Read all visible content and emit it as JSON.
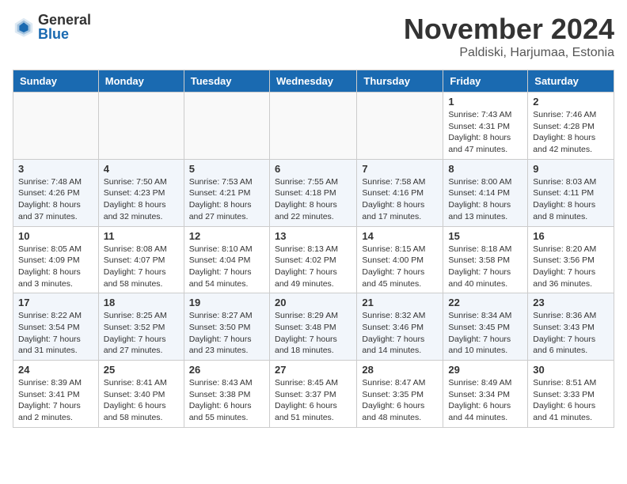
{
  "header": {
    "logo_general": "General",
    "logo_blue": "Blue",
    "month_title": "November 2024",
    "subtitle": "Paldiski, Harjumaa, Estonia"
  },
  "weekdays": [
    "Sunday",
    "Monday",
    "Tuesday",
    "Wednesday",
    "Thursday",
    "Friday",
    "Saturday"
  ],
  "weeks": [
    [
      {
        "day": "",
        "info": ""
      },
      {
        "day": "",
        "info": ""
      },
      {
        "day": "",
        "info": ""
      },
      {
        "day": "",
        "info": ""
      },
      {
        "day": "",
        "info": ""
      },
      {
        "day": "1",
        "info": "Sunrise: 7:43 AM\nSunset: 4:31 PM\nDaylight: 8 hours and 47 minutes."
      },
      {
        "day": "2",
        "info": "Sunrise: 7:46 AM\nSunset: 4:28 PM\nDaylight: 8 hours and 42 minutes."
      }
    ],
    [
      {
        "day": "3",
        "info": "Sunrise: 7:48 AM\nSunset: 4:26 PM\nDaylight: 8 hours and 37 minutes."
      },
      {
        "day": "4",
        "info": "Sunrise: 7:50 AM\nSunset: 4:23 PM\nDaylight: 8 hours and 32 minutes."
      },
      {
        "day": "5",
        "info": "Sunrise: 7:53 AM\nSunset: 4:21 PM\nDaylight: 8 hours and 27 minutes."
      },
      {
        "day": "6",
        "info": "Sunrise: 7:55 AM\nSunset: 4:18 PM\nDaylight: 8 hours and 22 minutes."
      },
      {
        "day": "7",
        "info": "Sunrise: 7:58 AM\nSunset: 4:16 PM\nDaylight: 8 hours and 17 minutes."
      },
      {
        "day": "8",
        "info": "Sunrise: 8:00 AM\nSunset: 4:14 PM\nDaylight: 8 hours and 13 minutes."
      },
      {
        "day": "9",
        "info": "Sunrise: 8:03 AM\nSunset: 4:11 PM\nDaylight: 8 hours and 8 minutes."
      }
    ],
    [
      {
        "day": "10",
        "info": "Sunrise: 8:05 AM\nSunset: 4:09 PM\nDaylight: 8 hours and 3 minutes."
      },
      {
        "day": "11",
        "info": "Sunrise: 8:08 AM\nSunset: 4:07 PM\nDaylight: 7 hours and 58 minutes."
      },
      {
        "day": "12",
        "info": "Sunrise: 8:10 AM\nSunset: 4:04 PM\nDaylight: 7 hours and 54 minutes."
      },
      {
        "day": "13",
        "info": "Sunrise: 8:13 AM\nSunset: 4:02 PM\nDaylight: 7 hours and 49 minutes."
      },
      {
        "day": "14",
        "info": "Sunrise: 8:15 AM\nSunset: 4:00 PM\nDaylight: 7 hours and 45 minutes."
      },
      {
        "day": "15",
        "info": "Sunrise: 8:18 AM\nSunset: 3:58 PM\nDaylight: 7 hours and 40 minutes."
      },
      {
        "day": "16",
        "info": "Sunrise: 8:20 AM\nSunset: 3:56 PM\nDaylight: 7 hours and 36 minutes."
      }
    ],
    [
      {
        "day": "17",
        "info": "Sunrise: 8:22 AM\nSunset: 3:54 PM\nDaylight: 7 hours and 31 minutes."
      },
      {
        "day": "18",
        "info": "Sunrise: 8:25 AM\nSunset: 3:52 PM\nDaylight: 7 hours and 27 minutes."
      },
      {
        "day": "19",
        "info": "Sunrise: 8:27 AM\nSunset: 3:50 PM\nDaylight: 7 hours and 23 minutes."
      },
      {
        "day": "20",
        "info": "Sunrise: 8:29 AM\nSunset: 3:48 PM\nDaylight: 7 hours and 18 minutes."
      },
      {
        "day": "21",
        "info": "Sunrise: 8:32 AM\nSunset: 3:46 PM\nDaylight: 7 hours and 14 minutes."
      },
      {
        "day": "22",
        "info": "Sunrise: 8:34 AM\nSunset: 3:45 PM\nDaylight: 7 hours and 10 minutes."
      },
      {
        "day": "23",
        "info": "Sunrise: 8:36 AM\nSunset: 3:43 PM\nDaylight: 7 hours and 6 minutes."
      }
    ],
    [
      {
        "day": "24",
        "info": "Sunrise: 8:39 AM\nSunset: 3:41 PM\nDaylight: 7 hours and 2 minutes."
      },
      {
        "day": "25",
        "info": "Sunrise: 8:41 AM\nSunset: 3:40 PM\nDaylight: 6 hours and 58 minutes."
      },
      {
        "day": "26",
        "info": "Sunrise: 8:43 AM\nSunset: 3:38 PM\nDaylight: 6 hours and 55 minutes."
      },
      {
        "day": "27",
        "info": "Sunrise: 8:45 AM\nSunset: 3:37 PM\nDaylight: 6 hours and 51 minutes."
      },
      {
        "day": "28",
        "info": "Sunrise: 8:47 AM\nSunset: 3:35 PM\nDaylight: 6 hours and 48 minutes."
      },
      {
        "day": "29",
        "info": "Sunrise: 8:49 AM\nSunset: 3:34 PM\nDaylight: 6 hours and 44 minutes."
      },
      {
        "day": "30",
        "info": "Sunrise: 8:51 AM\nSunset: 3:33 PM\nDaylight: 6 hours and 41 minutes."
      }
    ]
  ]
}
